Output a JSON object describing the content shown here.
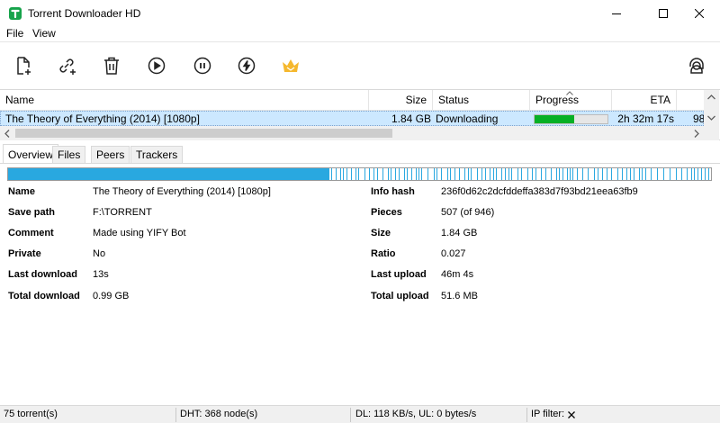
{
  "window": {
    "title": "Torrent Downloader HD",
    "accent": "#16a34a"
  },
  "menu": {
    "file": "File",
    "view": "View"
  },
  "toolbar": {
    "buttons": [
      "add-file-icon",
      "add-link-icon",
      "delete-icon",
      "resume-icon",
      "pause-icon",
      "force-start-icon",
      "premium-crown-icon",
      "support-agent-icon"
    ]
  },
  "list": {
    "columns": {
      "name": "Name",
      "size": "Size",
      "status": "Status",
      "progress": "Progress",
      "eta": "ETA"
    },
    "rows": [
      {
        "name": "The Theory of Everything (2014) [1080p]",
        "size": "1.84 GB",
        "status": "Downloading",
        "progress": 0.54,
        "eta": "2h 32m 17s",
        "extra": "98"
      }
    ]
  },
  "tabs": [
    "Overview",
    "Files",
    "Peers",
    "Trackers"
  ],
  "overview": {
    "left": [
      {
        "label": "Name",
        "value": "The Theory of Everything (2014) [1080p]"
      },
      {
        "label": "Save path",
        "value": "F:\\TORRENT"
      },
      {
        "label": "Comment",
        "value": "Made using YIFY Bot"
      },
      {
        "label": "Private",
        "value": "No"
      },
      {
        "label": "Last download",
        "value": "13s"
      },
      {
        "label": "Total download",
        "value": "0.99 GB"
      }
    ],
    "right": [
      {
        "label": "Info hash",
        "value": "236f0d62c2dcfddeffa383d7f93bd21eea63fb9"
      },
      {
        "label": "Pieces",
        "value": "507 (of 946)"
      },
      {
        "label": "Size",
        "value": "1.84 GB"
      },
      {
        "label": "Ratio",
        "value": "0.027"
      },
      {
        "label": "Last upload",
        "value": "46m 4s"
      },
      {
        "label": "Total upload",
        "value": "51.6 MB"
      }
    ]
  },
  "pieces_bar": {
    "complete_fraction": 0.457,
    "color": "#29a8e0"
  },
  "statusbar": {
    "torrents": "75 torrent(s)",
    "dht": "DHT: 368 node(s)",
    "speed": "DL: 118 KB/s, UL: 0 bytes/s",
    "ipfilter": "IP filter:"
  }
}
